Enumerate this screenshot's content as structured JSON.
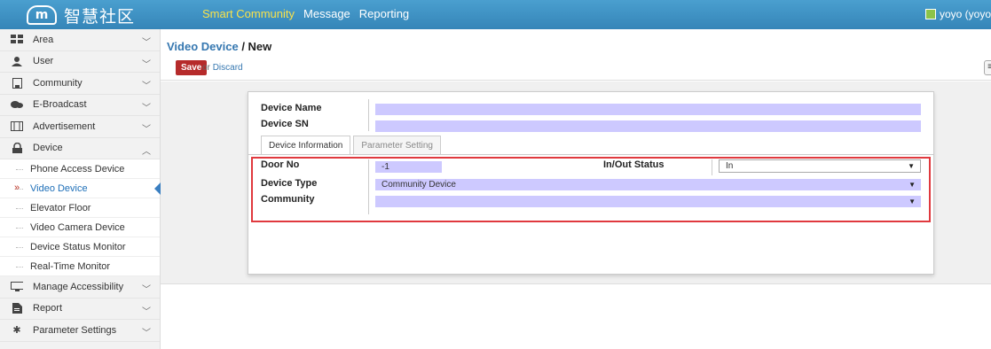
{
  "header": {
    "logo_mark": "m",
    "logo_text": "智慧社区",
    "nav": [
      "Smart Community",
      "Message",
      "Reporting"
    ],
    "user": "yoyo (yoyo"
  },
  "sidebar": {
    "items": [
      {
        "label": "Area",
        "icon": "grid-icon"
      },
      {
        "label": "User",
        "icon": "user-icon"
      },
      {
        "label": "Community",
        "icon": "building-icon"
      },
      {
        "label": "E-Broadcast",
        "icon": "broadcast-icon"
      },
      {
        "label": "Advertisement",
        "icon": "ad-icon"
      },
      {
        "label": "Device",
        "icon": "lock-icon"
      }
    ],
    "device_sub": [
      "Phone Access Device",
      "Video Device",
      "Elevator Floor",
      "Video Camera Device",
      "Device Status Monitor",
      "Real-Time Monitor"
    ],
    "items_after": [
      {
        "label": "Manage Accessibility",
        "icon": "monitor-icon"
      },
      {
        "label": "Report",
        "icon": "report-icon"
      },
      {
        "label": "Parameter Settings",
        "icon": "gear-icon"
      }
    ],
    "active_sub": "Video Device"
  },
  "breadcrumb": {
    "parent": "Video Device",
    "sep": " / ",
    "current": "New"
  },
  "actions": {
    "save": "Save",
    "or": "or",
    "discard": "Discard",
    "menu": "≡"
  },
  "form": {
    "device_name_label": "Device Name",
    "device_sn_label": "Device SN",
    "tabs": [
      "Device Information",
      "Parameter Setting"
    ],
    "door_no_label": "Door No",
    "door_no_value": "-1",
    "inout_label": "In/Out Status",
    "inout_value": "In",
    "device_type_label": "Device Type",
    "device_type_value": "Community Device",
    "community_label": "Community",
    "community_value": ""
  }
}
